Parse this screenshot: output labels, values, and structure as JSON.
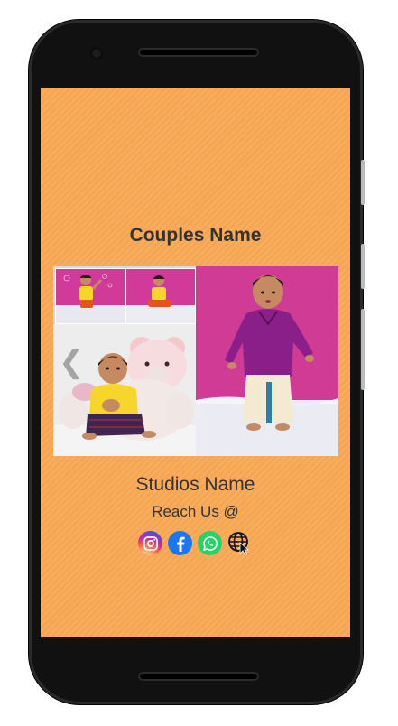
{
  "header": {
    "couples_name": "Couples Name"
  },
  "gallery": {
    "prev_arrow_glyph": "❮",
    "images": [
      {
        "name": "thumbnail-baby-bubbles"
      },
      {
        "name": "thumbnail-baby-floor"
      },
      {
        "name": "photo-baby-with-teddy-bear"
      },
      {
        "name": "photo-baby-standing-purple-shirt"
      }
    ]
  },
  "footer": {
    "studio_name": "Studios Name",
    "reach_us": "Reach Us @",
    "social_icons": [
      "instagram-icon",
      "facebook-icon",
      "whatsapp-icon",
      "website-globe-icon"
    ]
  },
  "colors": {
    "background": "#f9a955",
    "text": "#333333",
    "facebook": "#1877f2",
    "whatsapp": "#25d366"
  }
}
